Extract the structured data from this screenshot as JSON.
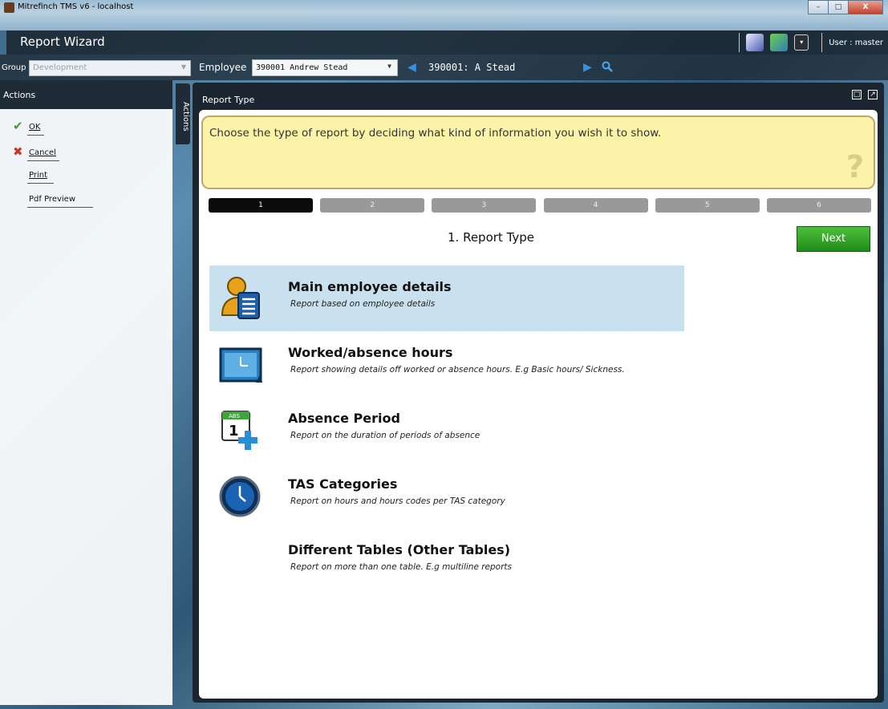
{
  "window": {
    "title": "Mitrefinch TMS v6 - localhost",
    "buttons": [
      "–",
      "□",
      "X"
    ]
  },
  "header": {
    "title": "Report Wizard",
    "user": "User : master"
  },
  "filters": {
    "group_label": "Group",
    "group_value": "Development",
    "employee_label": "Employee",
    "employee_value": "390001 Andrew Stead",
    "employee_current": "390001: A Stead"
  },
  "actions": {
    "header": "Actions",
    "tab_label": "Actions",
    "items": [
      "OK",
      "Cancel",
      "Print",
      "Pdf Preview"
    ]
  },
  "content": {
    "header": "Report Type",
    "hint": "Choose the type of report by deciding what kind of information you wish it to show.",
    "hint_mark": "?",
    "steps": [
      "1",
      "2",
      "3",
      "4",
      "5",
      "6"
    ],
    "step_title": "1. Report Type",
    "next_label": "Next",
    "report_types": [
      {
        "title": "Main employee details",
        "desc": "Report based on employee details",
        "icon": "employee-details-icon"
      },
      {
        "title": "Worked/absence hours",
        "desc": "Report showing details off worked or absence hours. E.g Basic hours/ Sickness.",
        "icon": "hours-screen-icon"
      },
      {
        "title": "Absence Period",
        "desc": "Report on the duration of periods of absence",
        "icon": "absence-calendar-icon"
      },
      {
        "title": "TAS Categories",
        "desc": "Report on hours and hours codes per TAS category",
        "icon": "clock-icon"
      },
      {
        "title": "Different Tables (Other Tables)",
        "desc": "Report on more than one table. E.g multiline reports",
        "icon": ""
      }
    ],
    "calendar_badge": "ABS",
    "calendar_day": "1"
  }
}
